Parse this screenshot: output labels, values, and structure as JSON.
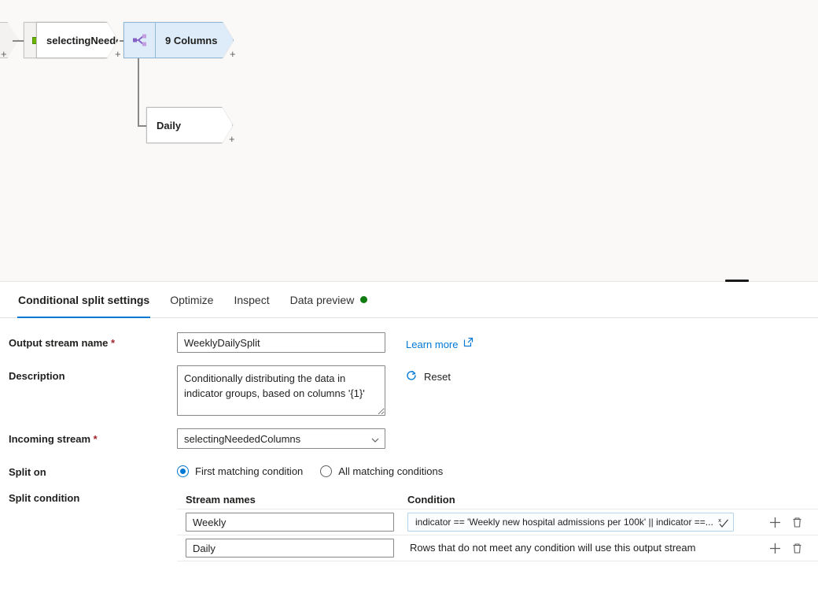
{
  "canvas": {
    "nodes": [
      {
        "id": "stub",
        "label": "",
        "icon": "chevron-stub",
        "style": "ghost"
      },
      {
        "id": "select",
        "label": "selectingNeede...",
        "icon": "select-transform-icon",
        "style": "white"
      },
      {
        "id": "columns",
        "label": "9 Columns",
        "icon": "conditional-split-icon",
        "style": "blue"
      },
      {
        "id": "daily",
        "label": "Daily",
        "icon": "none",
        "style": "white"
      }
    ],
    "add_marker": "+"
  },
  "tabs": [
    {
      "label": "Conditional split settings",
      "active": true,
      "status_dot": false
    },
    {
      "label": "Optimize",
      "active": false,
      "status_dot": false
    },
    {
      "label": "Inspect",
      "active": false,
      "status_dot": false
    },
    {
      "label": "Data preview",
      "active": false,
      "status_dot": true
    }
  ],
  "form": {
    "output_stream": {
      "label": "Output stream name",
      "required_mark": "*",
      "value": "WeeklyDailySplit",
      "placeholder": "Output stream name"
    },
    "learn_more": {
      "label": "Learn more",
      "icon": "external-link-icon"
    },
    "description": {
      "label": "Description",
      "value": "Conditionally distributing the data in indicator groups, based on columns '{1}'",
      "placeholder": "Description"
    },
    "reset": {
      "label": "Reset",
      "icon": "refresh-icon"
    },
    "incoming_stream": {
      "label": "Incoming stream",
      "required_mark": "*",
      "value": "selectingNeededColumns",
      "options": [
        "selectingNeededColumns"
      ]
    },
    "split_on": {
      "label": "Split on",
      "options": [
        {
          "label": "First matching condition",
          "selected": true
        },
        {
          "label": "All matching conditions",
          "selected": false
        }
      ]
    },
    "split_condition": {
      "label": "Split condition",
      "headers": {
        "stream": "Stream names",
        "condition": "Condition"
      },
      "rows": [
        {
          "stream_name": "Weekly",
          "condition": "indicator == 'Weekly new hospital admissions per 100k' || indicator ==...",
          "is_default": false,
          "expression_icon": "expression-builder-icon"
        },
        {
          "stream_name": "Daily",
          "condition": "Rows that do not meet any condition will use this output stream",
          "is_default": true,
          "expression_icon": ""
        }
      ],
      "actions": {
        "add": "add-row-icon",
        "delete": "delete-row-icon"
      }
    }
  },
  "colors": {
    "accent": "#0078d4",
    "required": "#a4262c",
    "status_dot": "#107c10",
    "node_blue_fill": "#deecf9",
    "node_blue_border": "#8fb9d9",
    "canvas_bg": "#faf9f8"
  }
}
